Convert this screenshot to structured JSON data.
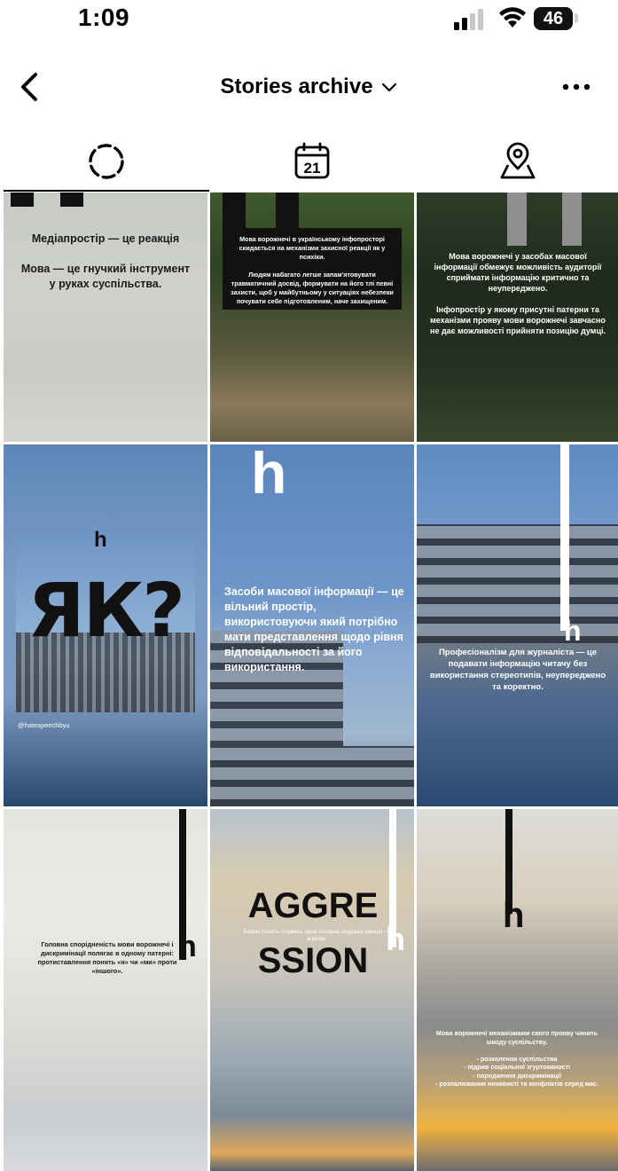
{
  "status_bar": {
    "time": "1:09",
    "battery": "46"
  },
  "header": {
    "title": "Stories archive"
  },
  "tabs": [
    {
      "name": "stories",
      "icon": "stories-ring-icon",
      "active": true
    },
    {
      "name": "calendar",
      "icon": "calendar-icon",
      "label": "21",
      "active": false
    },
    {
      "name": "map",
      "icon": "map-pin-icon",
      "active": false
    }
  ],
  "stories": [
    {
      "text": "Медіапростір — це реакція\n\nМова — це гнучкий інструмент у руках суспільства."
    },
    {
      "text": "Мова ворожнечі в українському інфопросторі скидається на механізми захисної реакції як у психіки.\n\nЛюдям набагато легше запам'ятовувати травматичний досвід, формувати на його тлі певні захисти, щоб у майбутньому у ситуаціях небезпеки почувати себе підготовленим, наче захищеним."
    },
    {
      "text": "Мова ворожнечі у засобах масової інформації обмежує можливість аудиторії сприймати інформацію критично та неупереджено.\n\nІнфопростір у якому присутні патерни та механізми прояву мови ворожнечі завчасно не дає можливості прийняти позицію думці."
    },
    {
      "text": "ЯК?",
      "logo": "h",
      "handle": "@hatespeechbyu"
    },
    {
      "text": "Засоби масової інформації — це вільний простір, використовуючи який потрібно мати представлення щодо рівня відповідальності за його використання.",
      "logo": "h"
    },
    {
      "text": "Професіоналізм для журналіста — це подавати інформацію читачу без використання стереотипів, неупереджено та коректно.",
      "logo": "h"
    },
    {
      "text": "Головна спорідненість мови ворожнечі і дискримінації полягає в одному патерні: протиставлення понять «я» чи «ми» проти «іншого».",
      "logo": "h"
    },
    {
      "text_top": "AGGRE",
      "text_bottom": "SSION",
      "caption": "Базою понять служить одна головна людська емоція — агресія.",
      "logo": "h"
    },
    {
      "text": "Мова ворожнечі механізмами свого прояву чинить шкоду суспільству.\n\n- розколення суспільства\n- підрив соціальної згуртованості\n- породження дискримінації\n- розпалювання ненависті та конфліктів серед мас.",
      "logo": "h"
    }
  ]
}
